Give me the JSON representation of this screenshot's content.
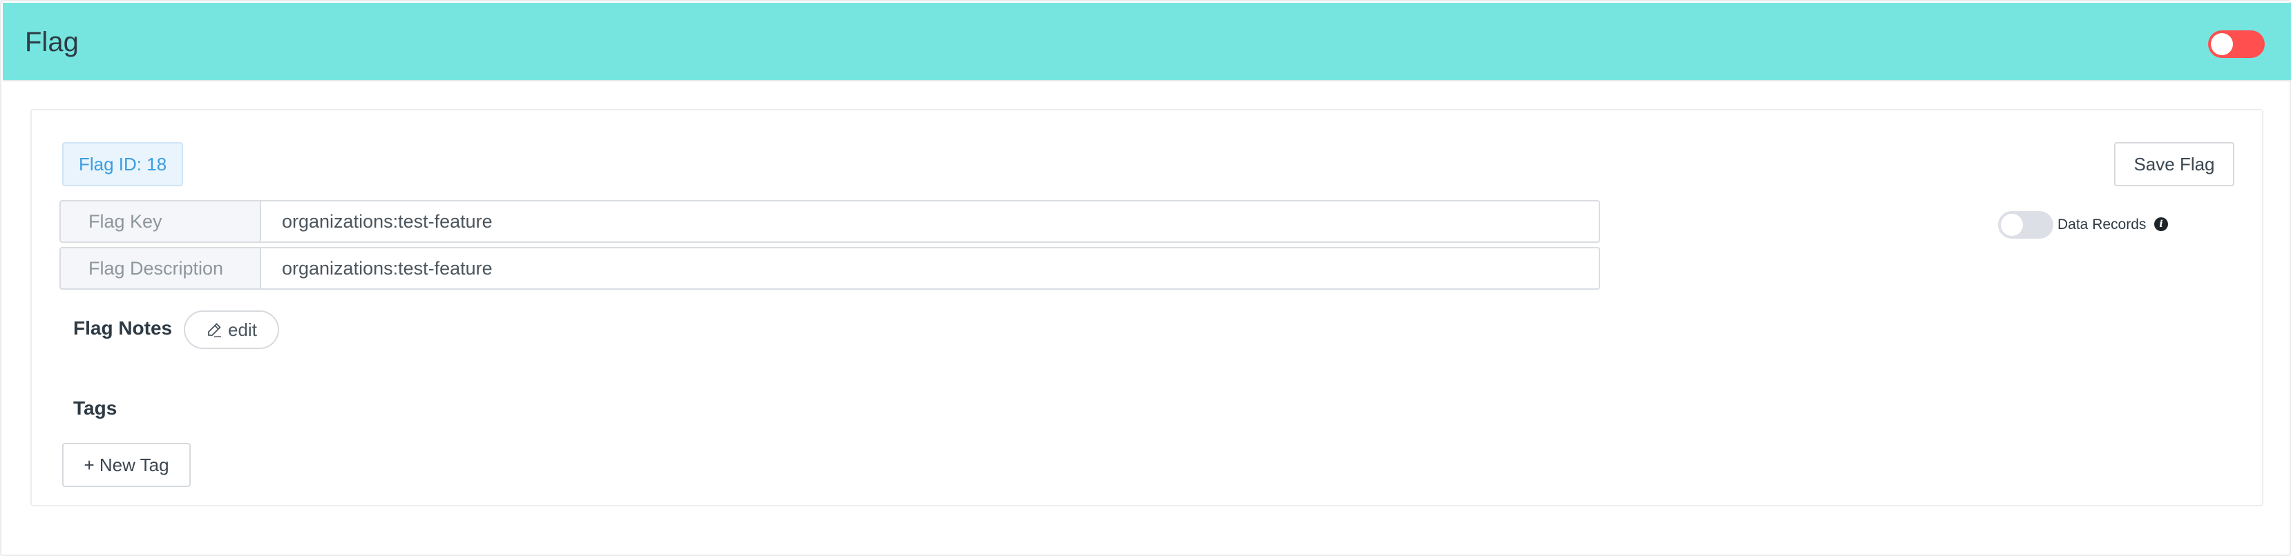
{
  "header": {
    "title": "Flag",
    "enabled": false,
    "toggle_color": "#ff4f4f",
    "background_color": "#76e5e0"
  },
  "flag": {
    "id_label": "Flag ID: 18",
    "save_label": "Save Flag",
    "key_label": "Flag Key",
    "key_value": "organizations:test-feature",
    "description_label": "Flag Description",
    "description_value": "organizations:test-feature",
    "data_records_label": "Data Records",
    "data_records_enabled": false,
    "info_icon": "info-icon"
  },
  "notes": {
    "label": "Flag Notes",
    "edit_label": "edit",
    "edit_icon": "pencil-icon"
  },
  "tags": {
    "label": "Tags",
    "new_tag_label": "+ New Tag"
  }
}
